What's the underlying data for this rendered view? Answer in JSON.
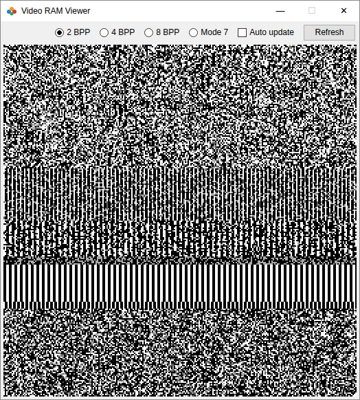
{
  "window": {
    "title": "Video RAM Viewer",
    "controls": [
      {
        "glyph": "—",
        "disabled": false
      },
      {
        "glyph": "☐",
        "disabled": true
      },
      {
        "glyph": "✕",
        "disabled": false
      }
    ]
  },
  "modes": [
    {
      "label": "2 BPP",
      "selected": true
    },
    {
      "label": "4 BPP",
      "selected": false
    },
    {
      "label": "8 BPP",
      "selected": false
    },
    {
      "label": "Mode 7",
      "selected": false
    }
  ],
  "auto_update": {
    "label": "Auto update",
    "checked": false
  },
  "buttons": [
    "Refresh"
  ]
}
